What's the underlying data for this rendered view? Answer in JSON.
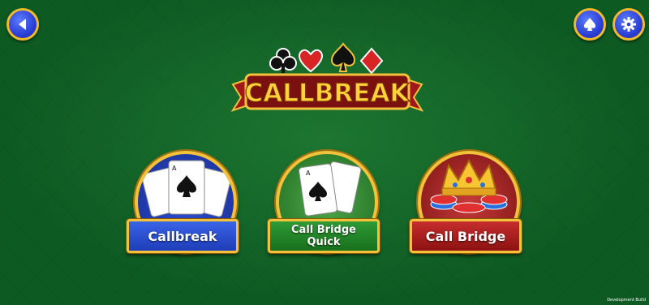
{
  "logo_text": "CALLBREAK",
  "modes": [
    {
      "label": "Callbreak",
      "color": "#2a4fd6"
    },
    {
      "label_line1": "Call Bridge",
      "label_line2": "Quick",
      "color": "#218a28"
    },
    {
      "label": "Call Bridge",
      "color": "#b01e1e"
    }
  ],
  "footer_label": "Development Build",
  "colors": {
    "felt": "#0e5a23",
    "gold_border": "#f3c23a",
    "icon_blue": "#2c3fd6"
  },
  "icons": {
    "back": "back-arrow-icon",
    "spade": "spade-icon",
    "settings": "gear-icon"
  }
}
